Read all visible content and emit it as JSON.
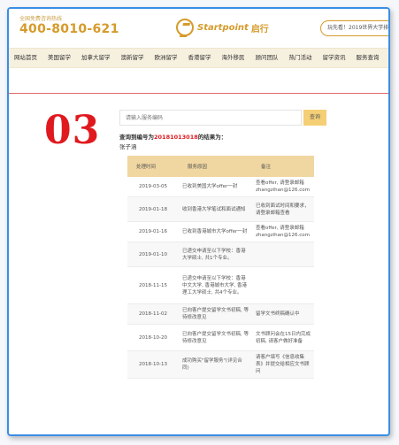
{
  "header": {
    "hotline_label": "全国免费咨询热线",
    "hotline": "400-8010-621",
    "logo_text": "Startpoint",
    "logo_cn": "启行",
    "search_text": "玩先看！2019世界大学排名"
  },
  "nav": {
    "items": [
      "网站首页",
      "美国留学",
      "加拿大留学",
      "澳新留学",
      "欧洲留学",
      "香港留学",
      "海外移民",
      "顾问团队",
      "热门活动",
      "留学资讯",
      "服务查询"
    ]
  },
  "big_number": "03",
  "query": {
    "placeholder": "请输入服务编码",
    "button": "查询"
  },
  "result": {
    "prefix": "查询到编号为",
    "code": "20181013018",
    "suffix": "的结果为：",
    "name": "张子涵"
  },
  "table": {
    "headers": [
      "处理时间",
      "服务原因",
      "备注"
    ],
    "rows": [
      [
        "2019-03-05",
        "已收到美国大学offer一封",
        "查看offer, 请登录邮箱zhangzihan@126.com"
      ],
      [
        "2019-01-18",
        "收到香港大学笔试和面试通知",
        "已收到面试时间和要求，请登录邮箱查看"
      ],
      [
        "2019-01-16",
        "已收到香港城市大学offer一封",
        "查看offer, 请登录邮箱zhangzihan@126.com"
      ],
      [
        "2019-01-10",
        "已递交申请至以下学校：香港大学硕士, 共1个专业。",
        ""
      ],
      [
        "2018-11-15",
        "已递交申请至以下学校：香港中文大学, 香港城市大学, 香港理工大学硕士, 共4个专业。",
        ""
      ],
      [
        "2018-11-02",
        "已向客户提交留学文书初稿, 等待修改意见",
        "留学文书终稿确认中"
      ],
      [
        "2018-10-20",
        "已向客户提交留学文书初稿, 等待修改意见",
        "文书顾问会在15日内完成初稿, 请客户做好准备"
      ],
      [
        "2018-10-13",
        "成功购买\"留学服务\"(详见合同)",
        "请客户填写《信息收集表》并提交给相应文书顾问"
      ]
    ]
  }
}
